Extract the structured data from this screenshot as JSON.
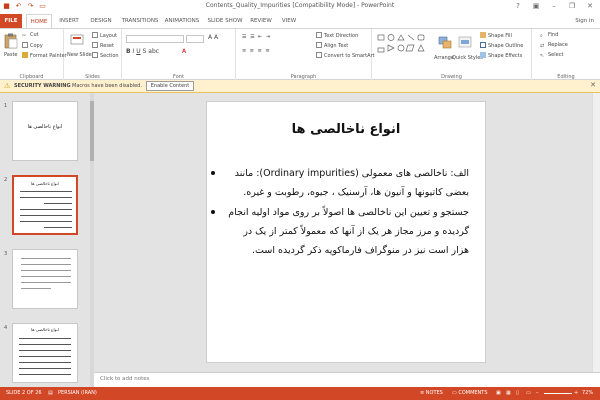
{
  "window": {
    "title": "Contents_Quality_Impurities [Compatibility Mode] - PowerPoint",
    "sign_in": "Sign in"
  },
  "tabs": [
    "FILE",
    "HOME",
    "INSERT",
    "DESIGN",
    "TRANSITIONS",
    "ANIMATIONS",
    "SLIDE SHOW",
    "REVIEW",
    "VIEW"
  ],
  "ribbon": {
    "clipboard": {
      "label": "Clipboard",
      "paste": "Paste",
      "cut": "Cut",
      "copy": "Copy",
      "format_painter": "Format Painter"
    },
    "slides": {
      "label": "Slides",
      "new_slide": "New Slide",
      "layout": "Layout",
      "reset": "Reset",
      "section": "Section"
    },
    "font": {
      "label": "Font"
    },
    "paragraph": {
      "label": "Paragraph",
      "text_direction": "Text Direction",
      "align_text": "Align Text",
      "convert": "Convert to SmartArt"
    },
    "drawing": {
      "label": "Drawing",
      "arrange": "Arrange",
      "quick_styles": "Quick Styles",
      "shape_fill": "Shape Fill",
      "shape_outline": "Shape Outline",
      "shape_effects": "Shape Effects"
    },
    "editing": {
      "label": "Editing",
      "find": "Find",
      "replace": "Replace",
      "select": "Select"
    }
  },
  "security_bar": {
    "label": "SECURITY WARNING",
    "text": "Macros have been disabled.",
    "button": "Enable Content"
  },
  "thumbnails": [
    {
      "num": "1",
      "title": "انواع ناخالصی ها"
    },
    {
      "num": "2",
      "title": "انواع ناخالصی ها"
    },
    {
      "num": "3",
      "title": ""
    },
    {
      "num": "4",
      "title": "انواع ناخالصی ها"
    }
  ],
  "slide": {
    "title": "انواع ناخالصی ها",
    "bullets": [
      "الف: ناخالصی های معمولی (Ordinary impurities): مانند بعضی کاتیونها و آنیون ها، آرسنیک ، جیوه، رطوبت و غیره.",
      "جستجو و تعیین این ناخالصی ها اصولاً بر روی مواد اولیه انجام گردیده و مرز مجاز هر یک از آنها که معمولاً کمتر از یک در هزار است نیز در منوگراف فارماکوپه ذکر گردیده است."
    ]
  },
  "notes_placeholder": "Click to add notes",
  "status": {
    "slide": "SLIDE 2 OF 26",
    "language": "PERSIAN (IRAN)",
    "notes": "NOTES",
    "comments": "COMMENTS",
    "zoom": "72%"
  },
  "colors": {
    "accent": "#d24726",
    "warning_bg": "#fff1ce"
  }
}
